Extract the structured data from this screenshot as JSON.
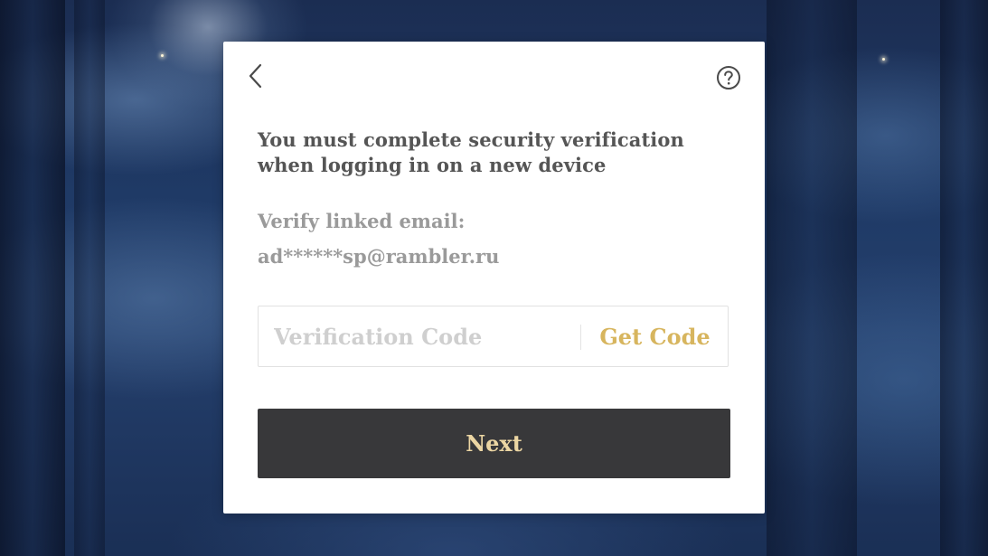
{
  "dialog": {
    "back_icon": "chevron-left-icon",
    "help_icon": "question-circle-icon",
    "notice": "You must complete security verification when logging in on a new device",
    "email_label": "Verify linked email:",
    "email_value": "ad******sp@rambler.ru",
    "code_input": {
      "placeholder": "Verification Code",
      "value": ""
    },
    "get_code_label": "Get Code",
    "next_label": "Next"
  },
  "colors": {
    "dialog_background": "#ffffff",
    "notice_text": "#555555",
    "secondary_text": "#9a9a9a",
    "placeholder_text": "#cfcfcf",
    "accent_gold": "#d7b55e",
    "next_button_background": "#38383a",
    "next_button_text": "#ecd6a3",
    "backdrop": "#1f3a66"
  }
}
